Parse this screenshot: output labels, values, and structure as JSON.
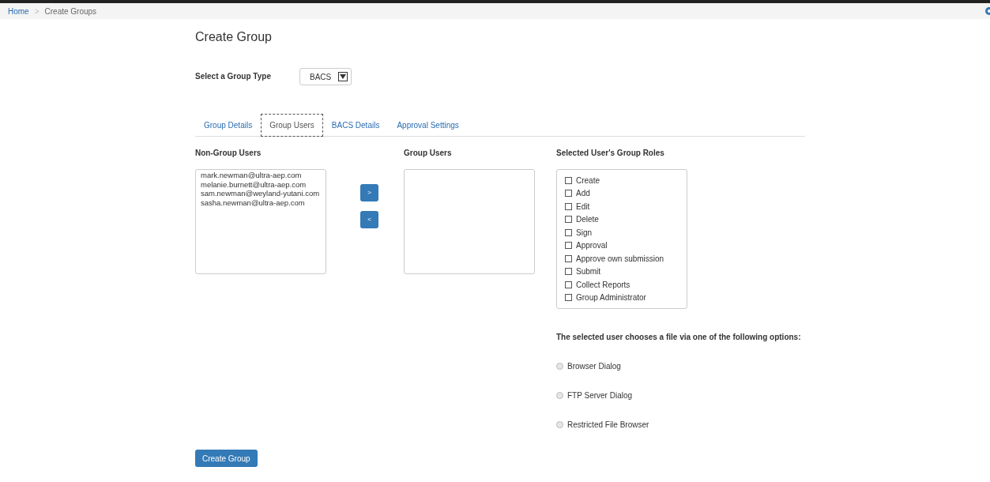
{
  "breadcrumb_separator": ">",
  "breadcrumb": [
    {
      "label": "Home",
      "link": true
    },
    {
      "label": "Create Groups",
      "link": false
    }
  ],
  "title": "Create Group",
  "group_type": {
    "label": "Select a Group Type",
    "value": "BACS"
  },
  "tabs": [
    {
      "label": "Group Details",
      "selected": false
    },
    {
      "label": "Group Users",
      "selected": true
    },
    {
      "label": "BACS Details",
      "selected": false
    },
    {
      "label": "Approval Settings",
      "selected": false
    }
  ],
  "non_group_users": {
    "heading": "Non-Group Users",
    "items": [
      "mark.newman@ultra-aep.com",
      "melanie.burnett@ultra-aep.com",
      "sam.newman@weyland-yutani.com",
      "sasha.newman@ultra-aep.com"
    ]
  },
  "move_buttons": [
    ">",
    "<"
  ],
  "group_users": {
    "heading": "Group Users"
  },
  "roles": {
    "heading": "Selected User's Group Roles",
    "items": [
      {
        "label": "Create",
        "checked": false
      },
      {
        "label": "Add",
        "checked": false
      },
      {
        "label": "Edit",
        "checked": false
      },
      {
        "label": "Delete",
        "checked": false
      },
      {
        "label": "Sign",
        "checked": false
      },
      {
        "label": "Approval",
        "checked": false
      },
      {
        "label": "Approve own submission",
        "checked": false
      },
      {
        "label": "Submit",
        "checked": false
      },
      {
        "label": "Collect Reports",
        "checked": false
      },
      {
        "label": "Group Administrator",
        "checked": false
      }
    ]
  },
  "file_options": {
    "heading": "The selected user chooses a file via one of the following options:",
    "items": [
      {
        "label": "Browser Dialog",
        "selected": false
      },
      {
        "label": "FTP Server Dialog",
        "selected": false
      },
      {
        "label": "Restricted File Browser",
        "selected": false
      }
    ]
  },
  "submit_button": "Create Group"
}
